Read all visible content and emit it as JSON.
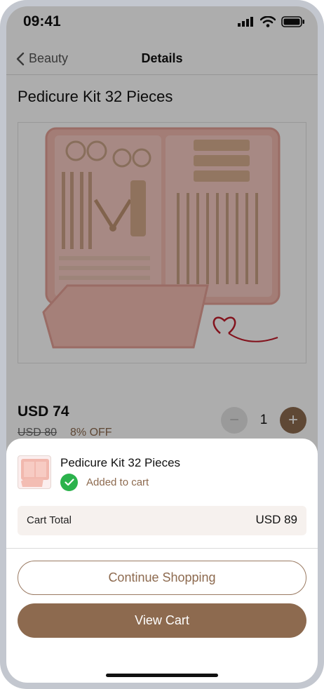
{
  "status_bar": {
    "time": "09:41"
  },
  "nav": {
    "back_label": "Beauty",
    "title": "Details"
  },
  "product": {
    "title": "Pedicure Kit 32 Pieces",
    "price": "USD 74",
    "old_price": "USD 80",
    "discount": "8% OFF",
    "quantity": "1",
    "minus_symbol": "−",
    "plus_symbol": "+"
  },
  "sheet": {
    "product_name": "Pedicure Kit 32 Pieces",
    "status_text": "Added to cart",
    "total_label": "Cart Total",
    "total_value": "USD 89",
    "continue_label": "Continue Shopping",
    "view_cart_label": "View Cart"
  },
  "colors": {
    "accent": "#8d6a4f",
    "success": "#2bb24c",
    "overlay": "rgba(0,0,0,0.32)"
  }
}
